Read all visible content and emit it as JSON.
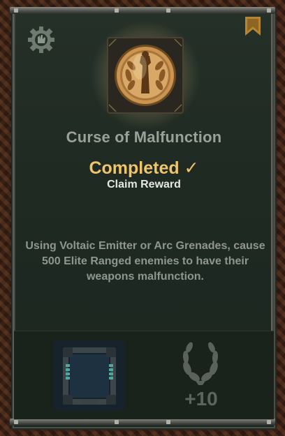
{
  "achievement": {
    "title": "Curse of Malfunction",
    "status": "Completed ✓",
    "claim_label": "Claim Reward",
    "description": "Using Voltaic Emitter or Arc Grenades, cause 500 Elite Ranged enemies to have their weapons malfunction."
  },
  "reward": {
    "amount": "+10"
  },
  "icons": {
    "category": "cog-fist-icon",
    "bookmark": "bookmark-icon",
    "medal": "gold-medal-icon",
    "reward_item": "portrait-frame-icon",
    "reward_points": "laurel-wreath-icon"
  },
  "colors": {
    "status": "#f2c46a",
    "title": "#9aa198",
    "card_bg": "#1f2a23",
    "bookmark": "#b8862f"
  }
}
